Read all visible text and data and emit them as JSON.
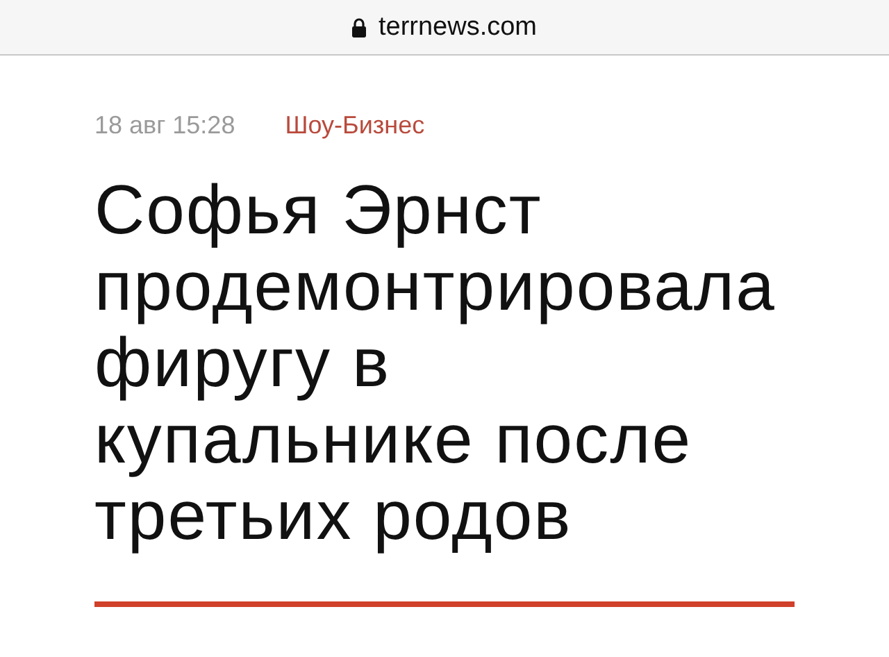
{
  "address_bar": {
    "secure": true,
    "url": "terrnews.com"
  },
  "article": {
    "date": "18 авг 15:28",
    "category": "Шоу-Бизнес",
    "headline": "Софья Эрнст продемонтрировала фиругу в купальнике после третьих родов"
  }
}
